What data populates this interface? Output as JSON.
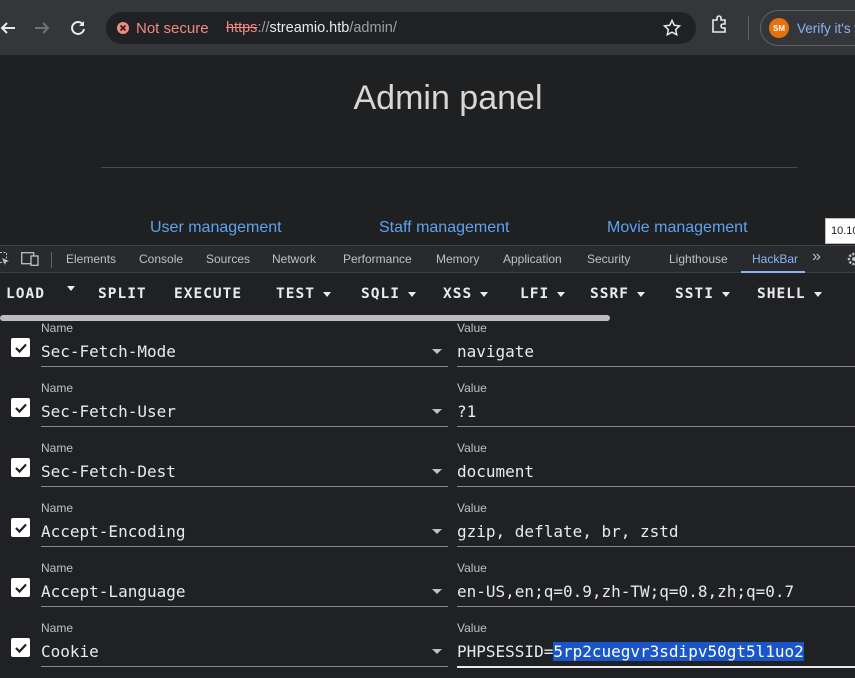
{
  "browser": {
    "security_label": "Not secure",
    "url_scheme": "https",
    "url_rest": "://",
    "url_host": "streamio.htb",
    "url_path": "/admin/",
    "verify_text": "Verify it's y",
    "verify_logo_text": "SM"
  },
  "page": {
    "title": "Admin panel",
    "links": [
      "User management",
      "Staff management",
      "Movie management"
    ],
    "ip_tooltip": "10.10"
  },
  "devtools": {
    "tabs": [
      "Elements",
      "Console",
      "Sources",
      "Network",
      "Performance",
      "Memory",
      "Application",
      "Security",
      "Lighthouse",
      "HackBar"
    ],
    "active_tab": "HackBar",
    "more_symbol": "»"
  },
  "hackbar": {
    "buttons": [
      {
        "label": "LOAD",
        "dropdown": false
      },
      {
        "label": "SPLIT",
        "dropdown": false
      },
      {
        "label": "EXECUTE",
        "dropdown": false
      },
      {
        "label": "TEST",
        "dropdown": true
      },
      {
        "label": "SQLI",
        "dropdown": true
      },
      {
        "label": "XSS",
        "dropdown": true
      },
      {
        "label": "LFI",
        "dropdown": true
      },
      {
        "label": "SSRF",
        "dropdown": true
      },
      {
        "label": "SSTI",
        "dropdown": true
      },
      {
        "label": "SHELL",
        "dropdown": true
      }
    ]
  },
  "headers": {
    "name_label": "Name",
    "value_label": "Value",
    "rows": [
      {
        "name": "Sec-Fetch-Mode",
        "value": "navigate",
        "checked": true
      },
      {
        "name": "Sec-Fetch-User",
        "value": "?1",
        "checked": true
      },
      {
        "name": "Sec-Fetch-Dest",
        "value": "document",
        "checked": true
      },
      {
        "name": "Accept-Encoding",
        "value": "gzip, deflate, br, zstd",
        "checked": true
      },
      {
        "name": "Accept-Language",
        "value": "en-US,en;q=0.9,zh-TW;q=0.8,zh;q=0.7",
        "checked": true
      },
      {
        "name": "Cookie",
        "value_prefix": "PHPSESSID=",
        "value_selected": "5rp2cuegvr3sdipv50gt5l1uo2",
        "checked": true
      }
    ]
  },
  "colors": {
    "accent": "#8ab4f8",
    "link": "#5ea2f0",
    "insecure": "#f28b82",
    "selection": "#1a56c9"
  }
}
